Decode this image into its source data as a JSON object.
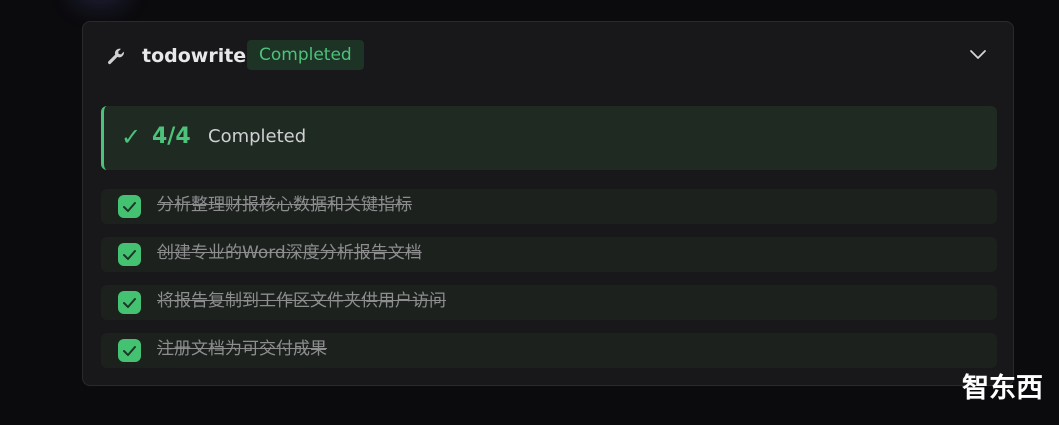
{
  "tool": {
    "icon": "wrench-icon",
    "name": "todowrite",
    "status": "Completed"
  },
  "summary": {
    "check": "✓",
    "count": "4/4",
    "label": "Completed"
  },
  "todos": [
    {
      "text": "分析整理财报核心数据和关键指标",
      "done": true
    },
    {
      "text": "创建专业的Word深度分析报告文档",
      "done": true
    },
    {
      "text": "将报告复制到工作区文件夹供用户访问",
      "done": true
    },
    {
      "text": "注册文档为可交付成果",
      "done": true
    }
  ],
  "watermark": "智东西",
  "colors": {
    "accent_green": "#4cc27a",
    "checkbox_green": "#44c272",
    "card_bg": "#18181a",
    "page_bg": "#0b0b0e"
  }
}
